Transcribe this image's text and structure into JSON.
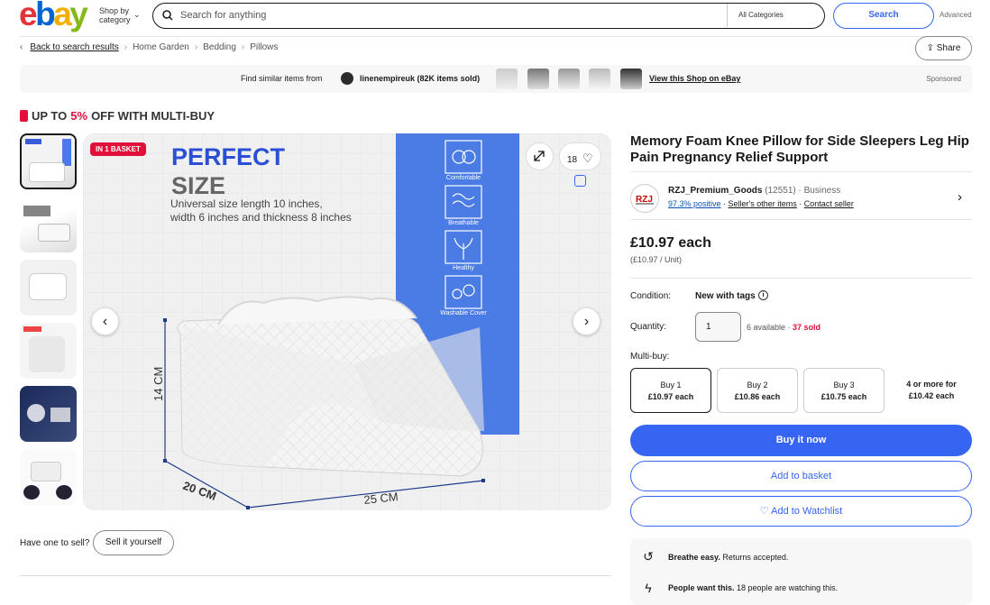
{
  "header": {
    "logo": [
      "e",
      "b",
      "a",
      "y"
    ],
    "shop_by": "Shop by category",
    "search_placeholder": "Search for anything",
    "category": "All Categories",
    "search_button": "Search",
    "advanced": "Advanced"
  },
  "breadcrumb": {
    "back": "Back to search results",
    "items": [
      "Home Garden",
      "Bedding",
      "Pillows"
    ],
    "share": "Share"
  },
  "banner": {
    "find_similar": "Find similar items from",
    "seller": "linenempireuk",
    "items_sold": "(82K items sold)",
    "view_shop": "View this Shop on eBay",
    "sponsored": "Sponsored"
  },
  "promo": {
    "prefix": "UP TO",
    "percent": "5%",
    "suffix": "OFF WITH MULTI-BUY"
  },
  "gallery": {
    "badge": "IN 1 BASKET",
    "watch_count": "18",
    "image": {
      "title_line1": "PERFECT",
      "title_line2": "SIZE",
      "desc_line1": "Universal size length 10 inches,",
      "desc_line2": "width 6 inches and thickness 8 inches",
      "features": [
        "Comfortable",
        "Breathable",
        "Healthy",
        "Washable Cover"
      ],
      "dim_height": "14 CM",
      "dim_width": "20 CM",
      "dim_length": "25 CM"
    }
  },
  "sell": {
    "question": "Have one to sell?",
    "button": "Sell it yourself"
  },
  "item": {
    "title": "Memory Foam Knee Pillow for Side Sleepers Leg Hip Pain Pregnancy Relief Support",
    "seller_name": "RZJ_Premium_Goods",
    "seller_score": "(12551)",
    "seller_type": "· Business",
    "positive": "97.3% positive",
    "other_items": "Seller's other items",
    "contact": "Contact seller",
    "price": "£10.97 each",
    "unit_price": "(£10.97 / Unit)",
    "condition_label": "Condition:",
    "condition_value": "New with tags",
    "quantity_label": "Quantity:",
    "quantity_value": "1",
    "available": "6 available ·",
    "sold": "37 sold",
    "multibuy_label": "Multi-buy:",
    "multibuy": [
      {
        "qty": "Buy 1",
        "price": "£10.97 each"
      },
      {
        "qty": "Buy 2",
        "price": "£10.86 each"
      },
      {
        "qty": "Buy 3",
        "price": "£10.75 each"
      }
    ],
    "multibuy_more_1": "4 or more for",
    "multibuy_more_2": "£10.42 each",
    "buy_now": "Buy it now",
    "add_basket": "Add to basket",
    "add_watchlist": "Add to Watchlist",
    "returns_bold": "Breathe easy.",
    "returns_text": "Returns accepted.",
    "watchers_bold": "People want this.",
    "watchers_text": "18 people are watching this."
  }
}
